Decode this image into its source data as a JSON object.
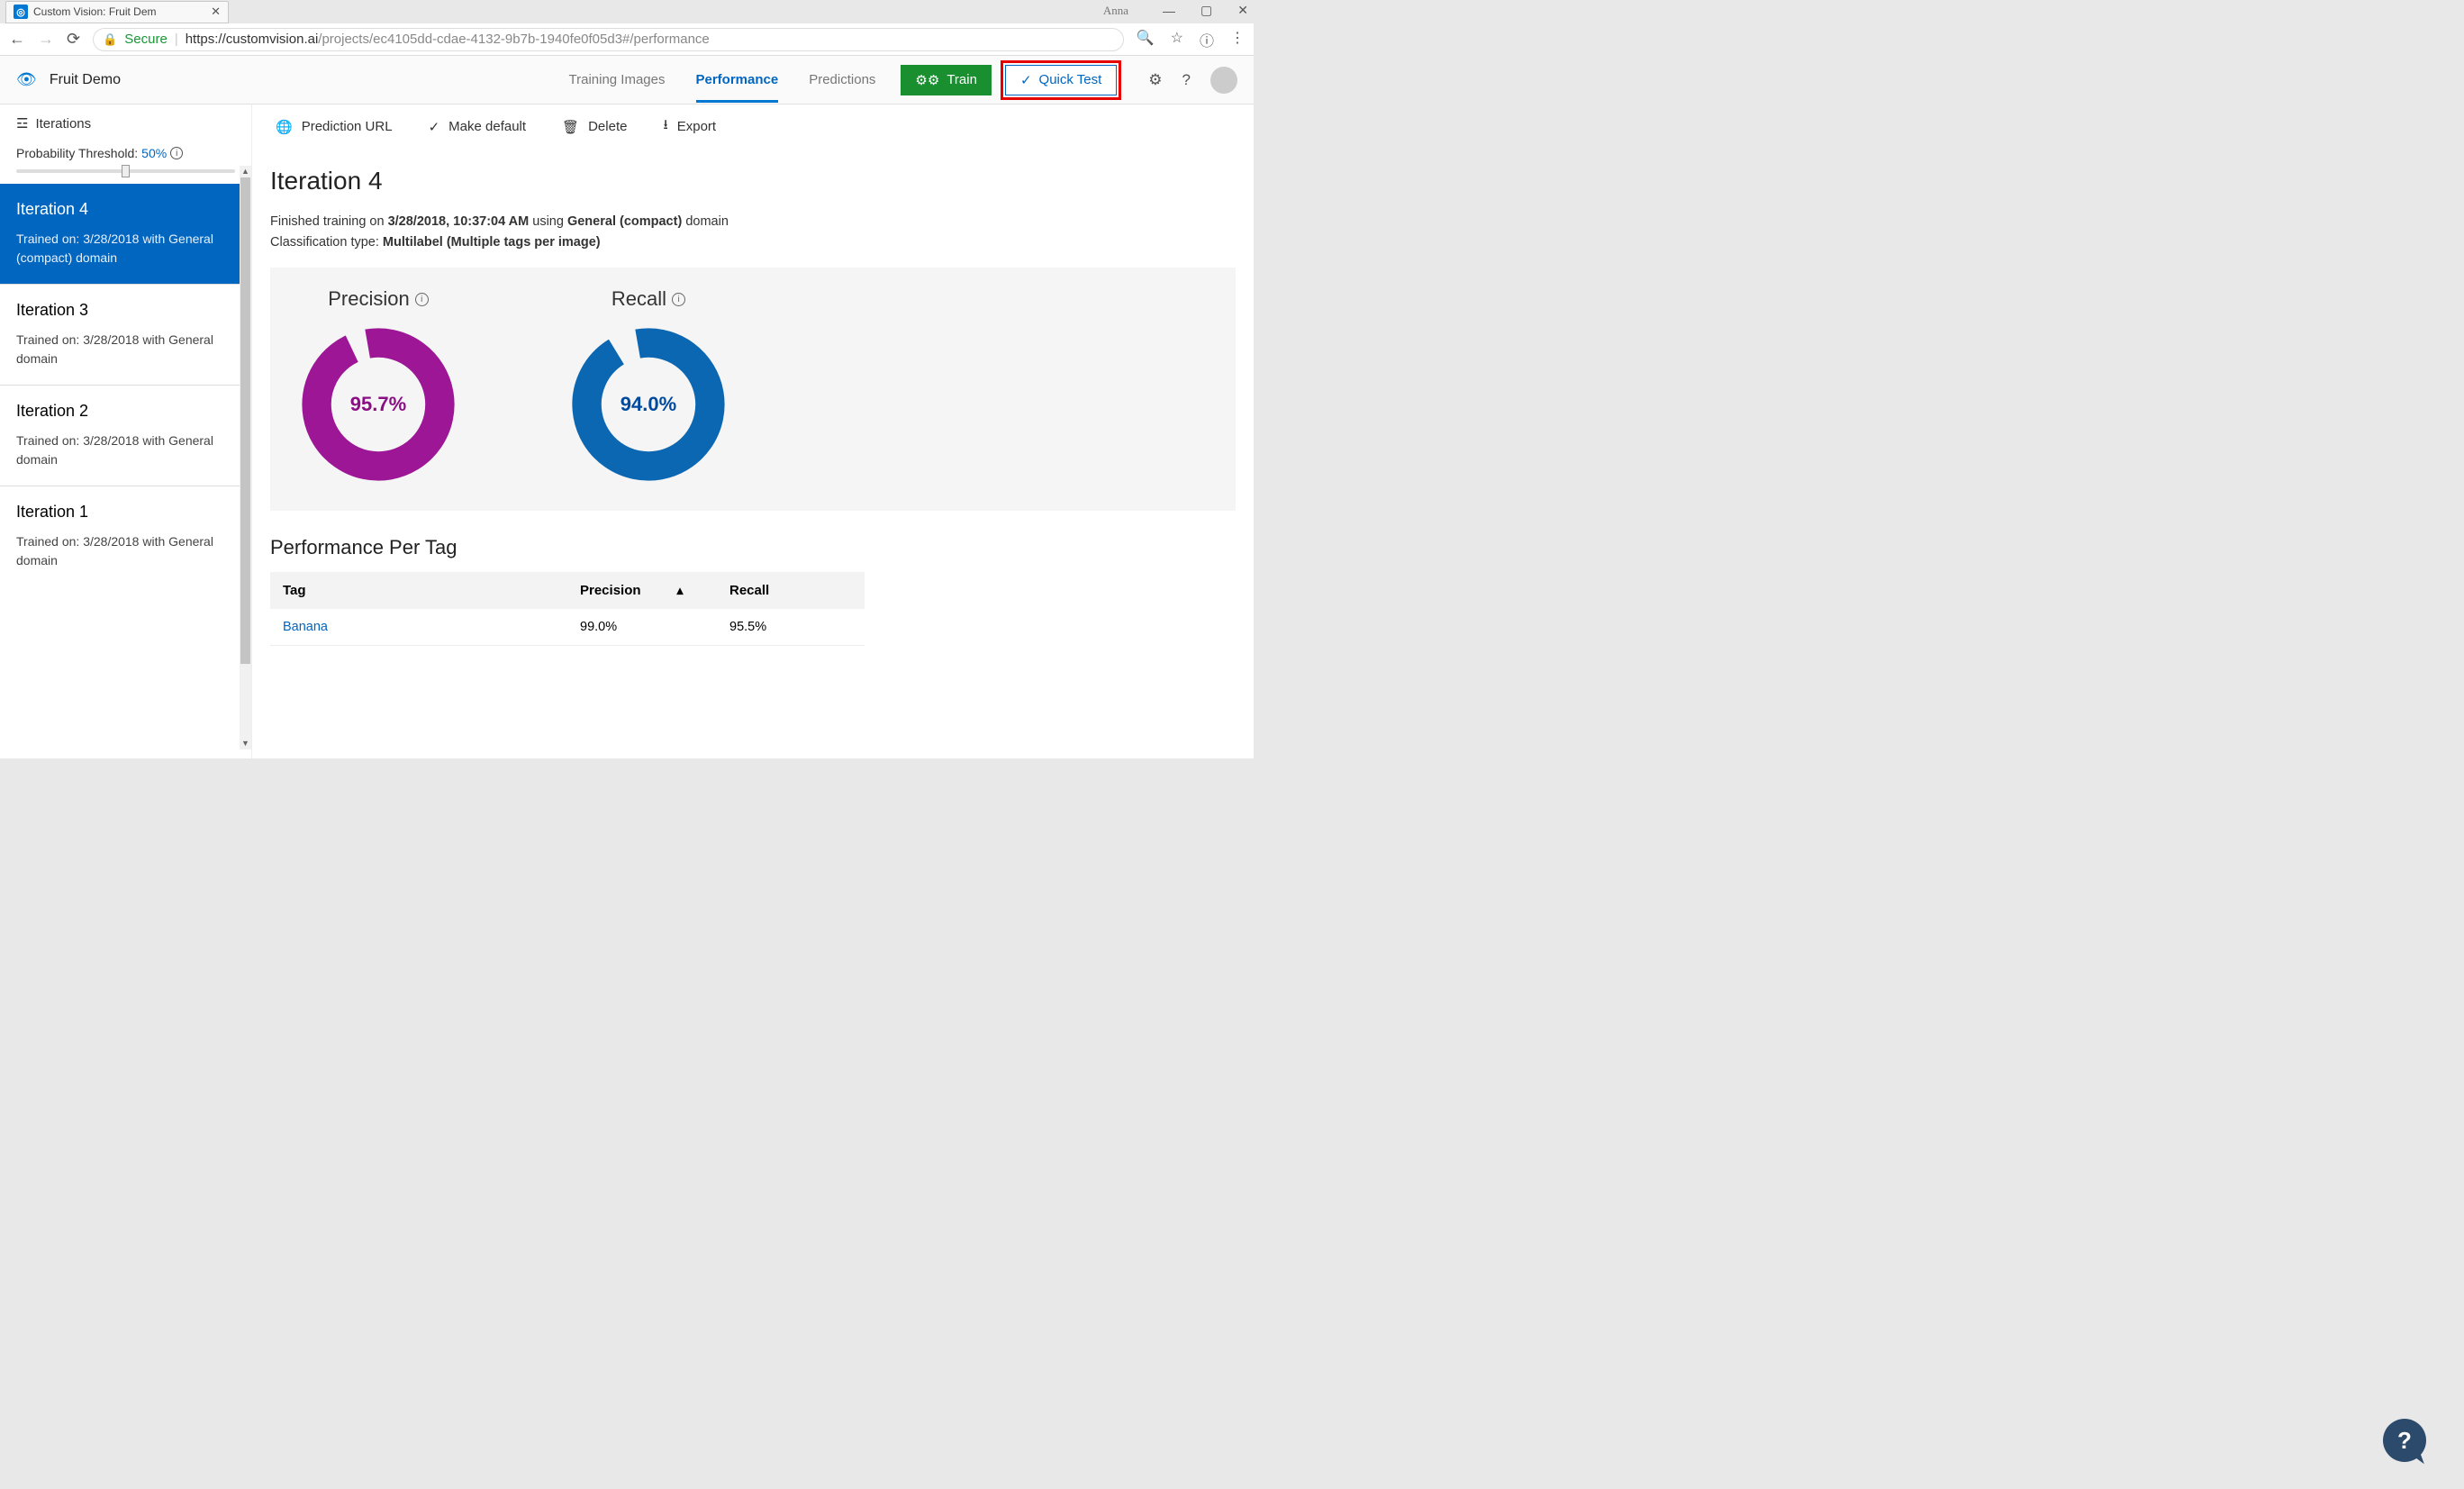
{
  "browser": {
    "tab_title": "Custom Vision: Fruit Dem",
    "username": "Anna",
    "secure_label": "Secure",
    "url_host": "https://customvision.ai",
    "url_path": "/projects/ec4105dd-cdae-4132-9b7b-1940fe0f05d3#/performance"
  },
  "header": {
    "project_name": "Fruit Demo",
    "tabs": {
      "training_images": "Training Images",
      "performance": "Performance",
      "predictions": "Predictions"
    },
    "train_btn": "Train",
    "quick_test_btn": "Quick Test"
  },
  "sidebar": {
    "iterations_label": "Iterations",
    "threshold_label": "Probability Threshold:",
    "threshold_value": "50%",
    "items": [
      {
        "title": "Iteration 4",
        "sub": "Trained on: 3/28/2018 with General (compact) domain"
      },
      {
        "title": "Iteration 3",
        "sub": "Trained on: 3/28/2018 with General domain"
      },
      {
        "title": "Iteration 2",
        "sub": "Trained on: 3/28/2018 with General domain"
      },
      {
        "title": "Iteration 1",
        "sub": "Trained on: 3/28/2018 with General domain"
      }
    ]
  },
  "toolbar": {
    "prediction_url": "Prediction URL",
    "make_default": "Make default",
    "delete": "Delete",
    "export": "Export"
  },
  "page": {
    "title": "Iteration 4",
    "meta_prefix": "Finished training on ",
    "meta_time": "3/28/2018, 10:37:04 AM",
    "meta_using": " using ",
    "meta_domain": "General (compact)",
    "meta_domain_suffix": " domain",
    "class_label": "Classification type: ",
    "class_value": "Multilabel (Multiple tags per image)"
  },
  "metrics": {
    "precision_label": "Precision",
    "precision_value": "95.7%",
    "recall_label": "Recall",
    "recall_value": "94.0%"
  },
  "per_tag": {
    "title": "Performance Per Tag",
    "columns": {
      "tag": "Tag",
      "precision": "Precision",
      "recall": "Recall"
    },
    "rows": [
      {
        "tag": "Banana",
        "precision": "99.0%",
        "recall": "95.5%"
      }
    ]
  },
  "chart_data": [
    {
      "type": "pie",
      "title": "Precision",
      "slices": [
        {
          "name": "Precision",
          "value": 95.7
        },
        {
          "name": "Remainder",
          "value": 4.3
        }
      ],
      "color": "#9c1696"
    },
    {
      "type": "pie",
      "title": "Recall",
      "slices": [
        {
          "name": "Recall",
          "value": 94.0
        },
        {
          "name": "Remainder",
          "value": 6.0
        }
      ],
      "color": "#0b67b2"
    }
  ]
}
